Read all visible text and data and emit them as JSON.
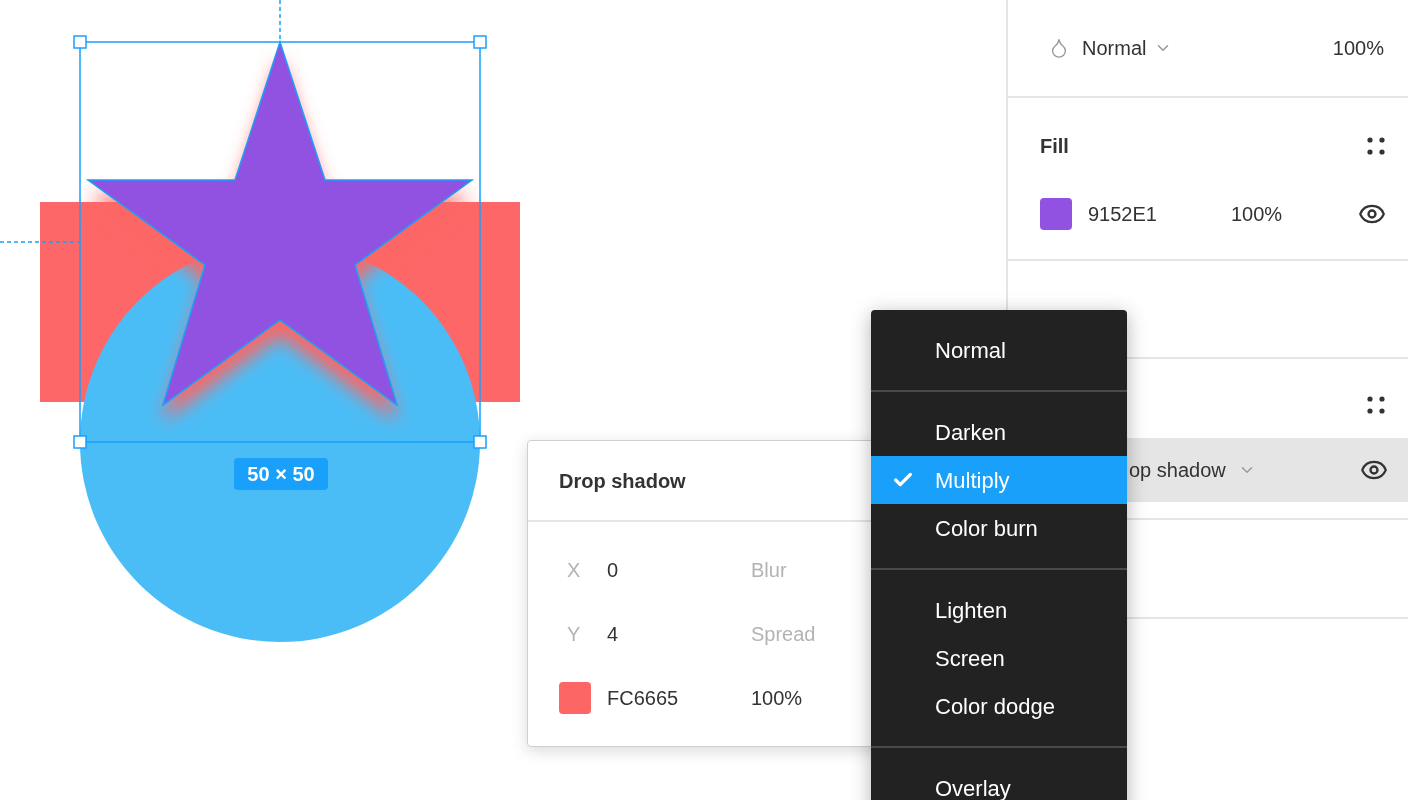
{
  "canvas": {
    "size_label": "50 × 50"
  },
  "layer": {
    "blend_mode": "Normal",
    "opacity": "100%"
  },
  "fill": {
    "title": "Fill",
    "color": "#9152e1",
    "hex": "9152E1",
    "opacity": "100%",
    "visible": true
  },
  "effects": {
    "effect_label": "op shadow",
    "visible": true
  },
  "shadow_popover": {
    "title": "Drop shadow",
    "fields": [
      {
        "label": "X",
        "value": "0"
      },
      {
        "label": "Blur"
      },
      {
        "label": "Y",
        "value": "4"
      },
      {
        "label": "Spread"
      }
    ],
    "color": "#fc6665",
    "hex": "FC6665",
    "opacity": "100%"
  },
  "blend_menu": {
    "groups": [
      [
        {
          "label": "Normal",
          "selected": false
        }
      ],
      [
        {
          "label": "Darken",
          "selected": false
        },
        {
          "label": "Multiply",
          "selected": true
        },
        {
          "label": "Color burn",
          "selected": false
        }
      ],
      [
        {
          "label": "Lighten",
          "selected": false
        },
        {
          "label": "Screen",
          "selected": false
        },
        {
          "label": "Color dodge",
          "selected": false
        }
      ],
      [
        {
          "label": "Overlay",
          "selected": false
        }
      ]
    ]
  }
}
